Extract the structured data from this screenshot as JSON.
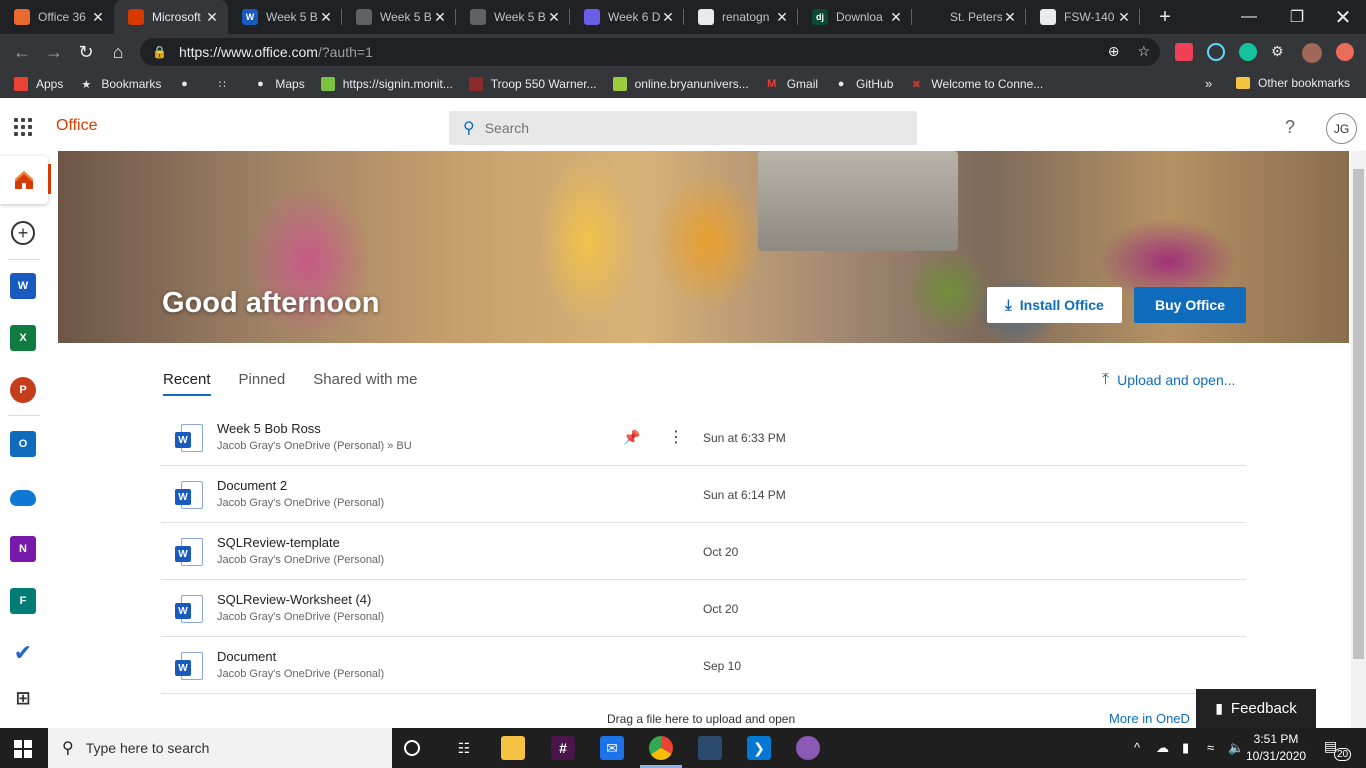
{
  "browser": {
    "tabs": [
      {
        "title": "Office 36",
        "fav_text": "",
        "fav_color": "#e86a2c"
      },
      {
        "title": "Microsoft",
        "fav_text": "",
        "fav_color": "#d83b01"
      },
      {
        "title": "Week 5 B",
        "fav_text": "W",
        "fav_color": "#185abd"
      },
      {
        "title": "Week 5 B",
        "fav_text": "",
        "fav_color": "#5f6368"
      },
      {
        "title": "Week 5 B",
        "fav_text": "",
        "fav_color": "#5f6368"
      },
      {
        "title": "Week 6 D",
        "fav_text": "",
        "fav_color": "#6b5de8"
      },
      {
        "title": "renatogn",
        "fav_text": "",
        "fav_color": "#e8eaed"
      },
      {
        "title": "Downloa",
        "fav_text": "dj",
        "fav_color": "#0c4b33"
      },
      {
        "title": "St. Peters",
        "fav_text": "",
        "fav_color": "#202124"
      },
      {
        "title": "FSW-140",
        "fav_text": "",
        "fav_color": "#e8eaed"
      }
    ],
    "new_tab_symbol": "+",
    "url_host": "https://www.office.com",
    "url_path": "/?auth=1",
    "bookmarks": [
      {
        "label": "Apps",
        "icon": "apps-grid-icon",
        "color": "#ea4335"
      },
      {
        "label": "Bookmarks",
        "icon": "star-icon",
        "color": "#e8eaed"
      },
      {
        "label": "",
        "icon": "globe-icon",
        "color": "#e8eaed"
      },
      {
        "label": "",
        "icon": "dots-icon",
        "color": "#e8eaed"
      },
      {
        "label": "Maps",
        "icon": "globe-icon",
        "color": "#e8eaed"
      },
      {
        "label": "https://signin.monit...",
        "icon": "wifi-icon",
        "color": "#7cc242"
      },
      {
        "label": "Troop 550 Warner...",
        "icon": "troop-icon",
        "color": "#8b2b2b"
      },
      {
        "label": "online.bryanunivers...",
        "icon": "bryan-icon",
        "color": "#9ccc3a"
      },
      {
        "label": "Gmail",
        "icon": "gmail-icon",
        "color": "#ea4335"
      },
      {
        "label": "GitHub",
        "icon": "github-icon",
        "color": "#e8eaed"
      },
      {
        "label": "Welcome to Conne...",
        "icon": "connect-icon",
        "color": "#c0392b"
      }
    ],
    "other_bookmarks": "Other bookmarks",
    "overflow": "»"
  },
  "office": {
    "app_name": "Office",
    "search_placeholder": "Search",
    "help": "?",
    "avatar_initials": "JG",
    "greeting": "Good afternoon",
    "install_label": "Install Office",
    "buy_label": "Buy Office",
    "tabs": [
      "Recent",
      "Pinned",
      "Shared with me"
    ],
    "upload_label": "Upload and open...",
    "files": [
      {
        "name": "Week 5 Bob Ross",
        "location": "Jacob Gray's OneDrive (Personal) » BU",
        "date": "Sun at 6:33 PM"
      },
      {
        "name": "Document 2",
        "location": "Jacob Gray's OneDrive (Personal)",
        "date": "Sun at 6:14 PM"
      },
      {
        "name": "SQLReview-template",
        "location": "Jacob Gray's OneDrive (Personal)",
        "date": "Oct 20"
      },
      {
        "name": "SQLReview-Worksheet (4)",
        "location": "Jacob Gray's OneDrive (Personal)",
        "date": "Oct 20"
      },
      {
        "name": "Document",
        "location": "Jacob Gray's OneDrive (Personal)",
        "date": "Sep 10"
      }
    ],
    "drag_hint": "Drag a file here to upload and open",
    "more_onedrive": "More in OneD",
    "feedback_label": "Feedback",
    "rail_apps": [
      {
        "name": "word",
        "letter": "W",
        "color": "#185abd"
      },
      {
        "name": "excel",
        "letter": "X",
        "color": "#107c41"
      },
      {
        "name": "powerpoint",
        "letter": "P",
        "color": "#c43e1c"
      },
      {
        "name": "outlook",
        "letter": "O",
        "color": "#0f6cbd"
      },
      {
        "name": "onedrive",
        "letter": "",
        "color": "#0f78d4"
      },
      {
        "name": "onenote",
        "letter": "N",
        "color": "#7719aa"
      },
      {
        "name": "forms",
        "letter": "F",
        "color": "#037c76"
      },
      {
        "name": "todo",
        "letter": "✔",
        "color": "#2564cf"
      }
    ]
  },
  "taskbar": {
    "search_placeholder": "Type here to search",
    "time": "3:51 PM",
    "date": "10/31/2020",
    "notification_count": "20"
  }
}
